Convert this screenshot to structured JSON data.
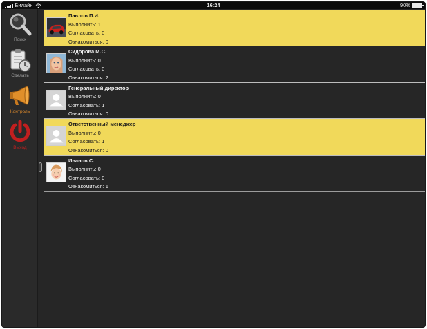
{
  "status_bar": {
    "carrier": "Билайн",
    "time": "16:24",
    "battery_text": "90%",
    "battery_level": 0.9
  },
  "sidebar": {
    "items": [
      {
        "label": "Поиск",
        "icon": "magnifier-icon"
      },
      {
        "label": "Сделать",
        "icon": "clipboard-clock-icon"
      },
      {
        "label": "Контроль",
        "icon": "megaphone-icon"
      },
      {
        "label": "Выход",
        "icon": "power-icon"
      }
    ]
  },
  "colors": {
    "highlight": "#f1d95a",
    "background": "#262626",
    "control_accent": "#d9872b",
    "exit_accent": "#c02020"
  },
  "people": [
    {
      "name": "Павлов П.И.",
      "execute": "Выполнить: 1",
      "approve": "Согласовать: 0",
      "review": "Ознакомиться: 0",
      "highlighted": true,
      "avatar": "car-photo"
    },
    {
      "name": "Сидорова М.С.",
      "execute": "Выполнить: 0",
      "approve": "Согласовать: 0",
      "review": "Ознакомиться: 2",
      "highlighted": false,
      "avatar": "woman-photo"
    },
    {
      "name": "Генеральный директор",
      "execute": "Выполнить: 0",
      "approve": "Согласовать: 1",
      "review": "Ознакомиться: 0",
      "highlighted": false,
      "avatar": "placeholder-user"
    },
    {
      "name": "Ответственный менеджер",
      "execute": "Выполнить: 0",
      "approve": "Согласовать: 1",
      "review": "Ознакомиться: 0",
      "highlighted": true,
      "avatar": "placeholder-user"
    },
    {
      "name": "Иванов С.",
      "execute": "Выполнить: 0",
      "approve": "Согласовать: 0",
      "review": "Ознакомиться: 1",
      "highlighted": false,
      "avatar": "child-photo"
    }
  ]
}
